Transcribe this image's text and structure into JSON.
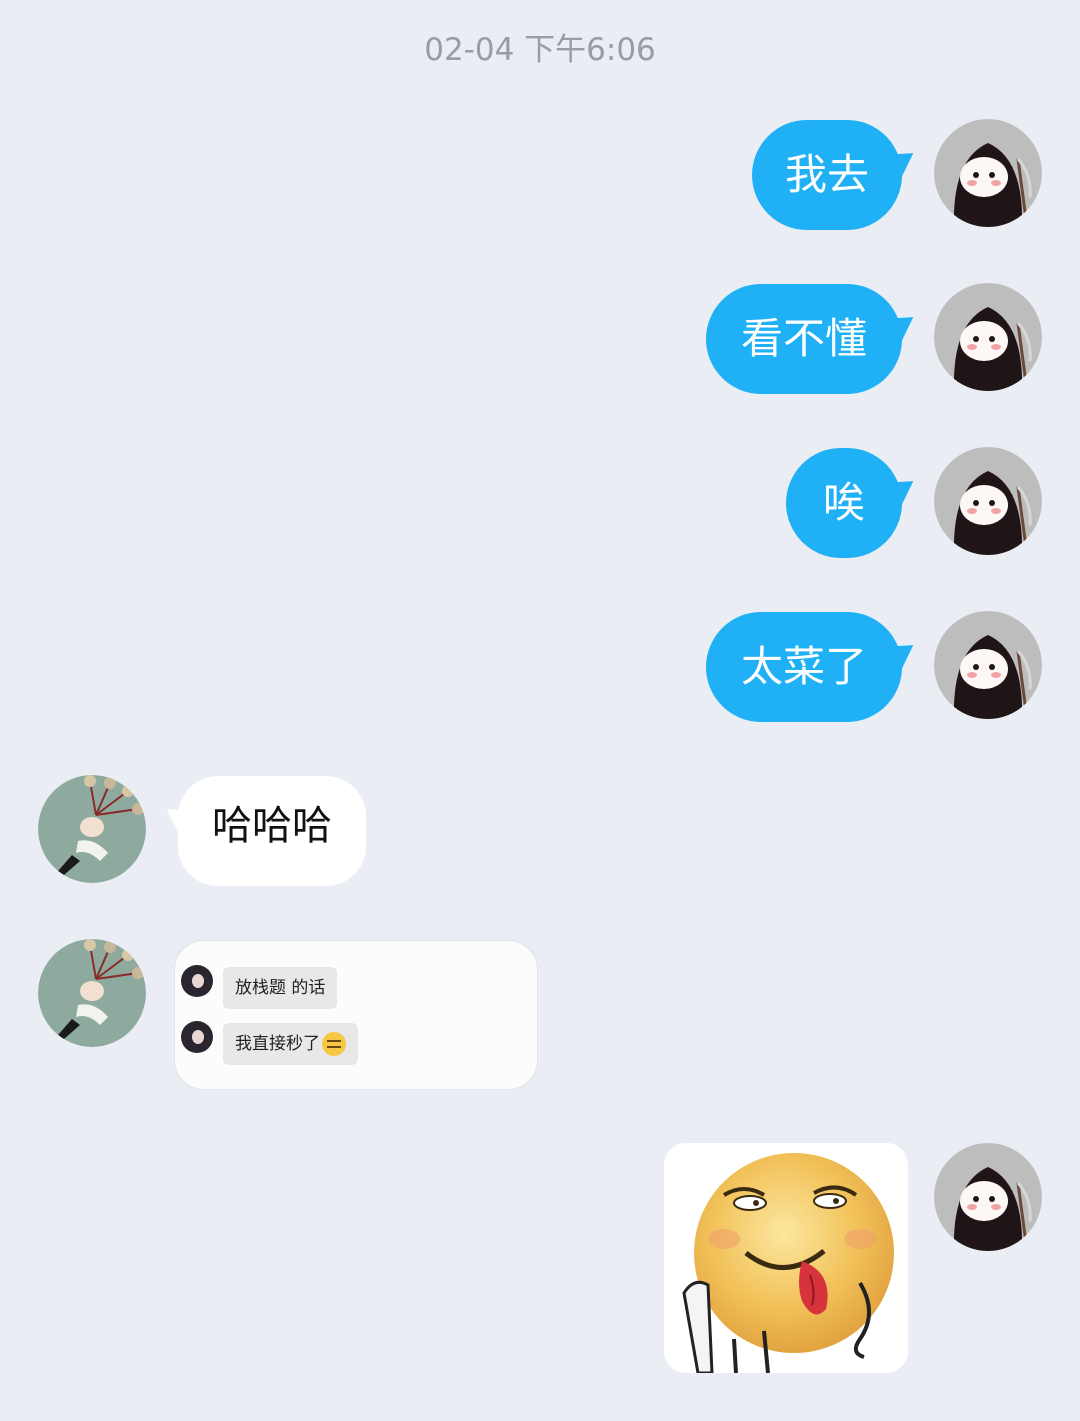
{
  "conversation": {
    "timestamp": "02-04 下午6:06",
    "messages": [
      {
        "sender": "self",
        "type": "text",
        "text": "我去"
      },
      {
        "sender": "self",
        "type": "text",
        "text": "看不懂"
      },
      {
        "sender": "self",
        "type": "text",
        "text": "唉"
      },
      {
        "sender": "self",
        "type": "text",
        "text": "太菜了"
      },
      {
        "sender": "other",
        "type": "text",
        "text": "哈哈哈"
      },
      {
        "sender": "other",
        "type": "forwarded-chat",
        "lines": [
          "放栈题 的话",
          "我直接秒了"
        ],
        "emoji": "grinning-squint-emoji"
      },
      {
        "sender": "self",
        "type": "sticker",
        "sticker": "tongue-out-laughing-face-sticker"
      }
    ]
  },
  "colors": {
    "background": "#eaedf4",
    "outgoing_bubble": "#1fb0f5",
    "incoming_bubble": "#ffffff",
    "timestamp_text": "#9a9ca2"
  },
  "avatars": {
    "self": "reaper-chibi-avatar",
    "other": "anime-character-avatar"
  }
}
